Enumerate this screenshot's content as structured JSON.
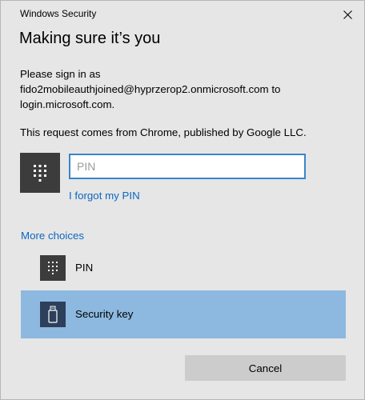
{
  "window": {
    "title": "Windows Security",
    "close_icon": "close-icon"
  },
  "content": {
    "heading": "Making sure it’s you",
    "sign_in_line1": "Please sign in as",
    "sign_in_line2": "fido2mobileauthjoined@hyprzerop2.onmicrosoft.com to",
    "sign_in_line3": "login.microsoft.com.",
    "request_origin": "This request comes from Chrome, published by Google LLC."
  },
  "pin": {
    "tile_icon": "keypad-icon",
    "placeholder": "PIN",
    "value": "",
    "forgot_link": "I forgot my PIN"
  },
  "choices": {
    "heading": "More choices",
    "items": [
      {
        "label": "PIN",
        "icon": "keypad-icon",
        "selected": false
      },
      {
        "label": "Security key",
        "icon": "usb-key-icon",
        "selected": true
      }
    ]
  },
  "buttons": {
    "cancel": "Cancel"
  },
  "colors": {
    "dialog_background": "#e6e6e6",
    "link": "#0c67c2",
    "input_border": "#3b85c8",
    "selected_choice": "#8db8e0",
    "icon_tile": "#3c3c3c",
    "button": "#cccccc"
  }
}
